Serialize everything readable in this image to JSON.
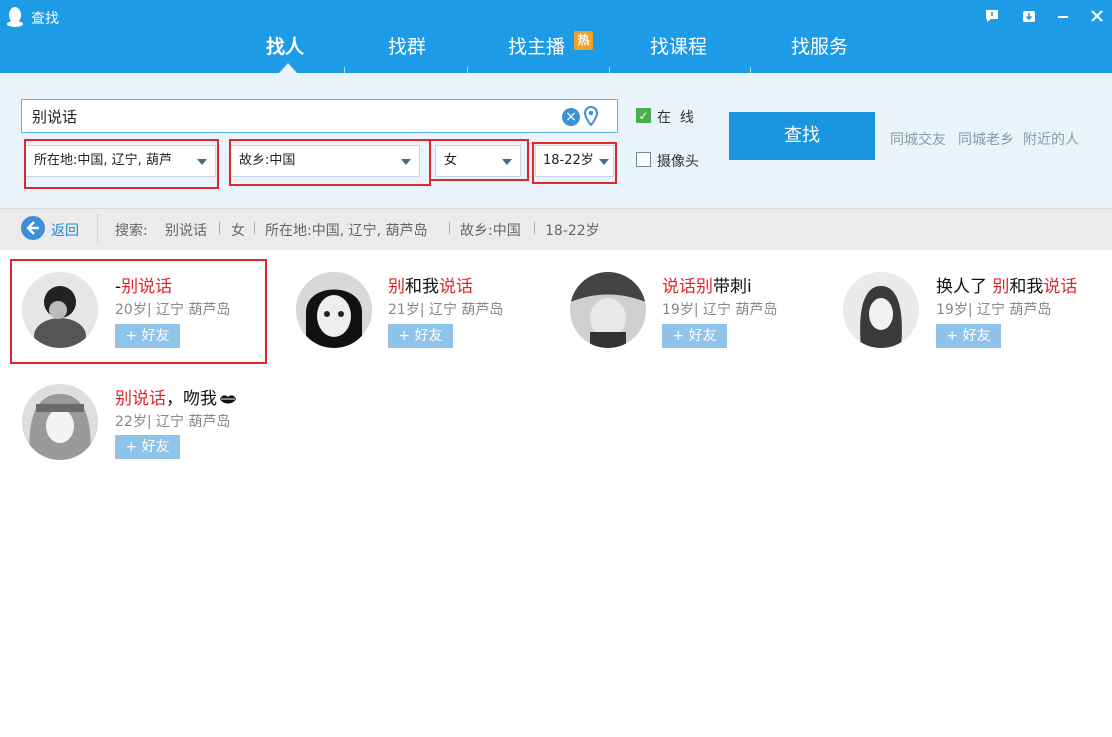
{
  "window": {
    "title": "查找"
  },
  "tabs": [
    {
      "label": "找人"
    },
    {
      "label": "找群"
    },
    {
      "label": "找主播",
      "badge": "热"
    },
    {
      "label": "找课程"
    },
    {
      "label": "找服务"
    }
  ],
  "search": {
    "query": "别说话"
  },
  "filters": {
    "location": "所在地:中国, 辽宁, 葫芦",
    "hometown": "故乡:中国",
    "gender": "女",
    "age": "18-22岁"
  },
  "options": {
    "online_label": "在  线",
    "online_checked": true,
    "camera_label": "摄像头",
    "camera_checked": false
  },
  "find_button": "查找",
  "quick_links": [
    "同城交友",
    "同城老乡",
    "附近的人"
  ],
  "breadcrumb": {
    "back": "返回",
    "prefix": "搜索:",
    "items": [
      "别说话",
      "女",
      "所在地:中国, 辽宁, 葫芦岛",
      "故乡:中国",
      "18-22岁"
    ]
  },
  "results": [
    {
      "name_parts": [
        "-",
        "别说话"
      ],
      "info": "20岁| 辽宁  葫芦岛",
      "add": "+ 好友"
    },
    {
      "name_parts": [
        "别",
        "和我",
        "说话"
      ],
      "info": "21岁| 辽宁  葫芦岛",
      "add": "+ 好友"
    },
    {
      "name_parts": [
        "说话别",
        "带刺i"
      ],
      "info": "19岁| 辽宁  葫芦岛",
      "add": "+ 好友"
    },
    {
      "name_parts": [
        "换人了 ",
        "别",
        "和我",
        "说话"
      ],
      "info": "19岁| 辽宁  葫芦岛",
      "add": "+ 好友"
    },
    {
      "name_parts": [
        "别说话",
        "，吻我"
      ],
      "info": "22岁| 辽宁  葫芦岛",
      "add": "+ 好友"
    }
  ],
  "colors": {
    "topbar": "#1e9be6",
    "accent": "#1c95e0",
    "highlight": "#e0262b",
    "annotation": "#e0262b"
  }
}
